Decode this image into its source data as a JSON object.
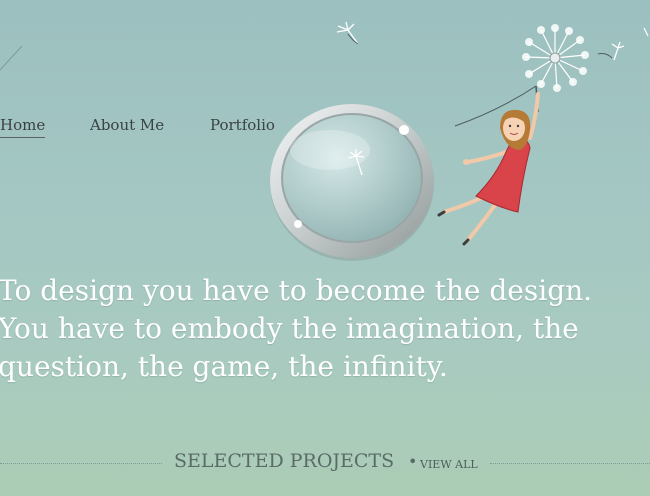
{
  "nav": {
    "items": [
      {
        "label": "Home",
        "active": true
      },
      {
        "label": "About Me",
        "active": false
      },
      {
        "label": "Portfolio",
        "active": false
      }
    ]
  },
  "hero": {
    "tagline_lines": [
      "To design you have to become the design.",
      "You have to embody the imagination, the",
      "question, the game, the infinity."
    ]
  },
  "projects": {
    "title": "SELECTED PROJECTS",
    "separator": "•",
    "view_all_label": "VIEW ALL"
  },
  "colors": {
    "background_top": "#9cc0bf",
    "background_bottom": "#abcdb5",
    "tagline": "#ffffff",
    "nav_text": "#3a4242",
    "dress": "#d9444a"
  }
}
